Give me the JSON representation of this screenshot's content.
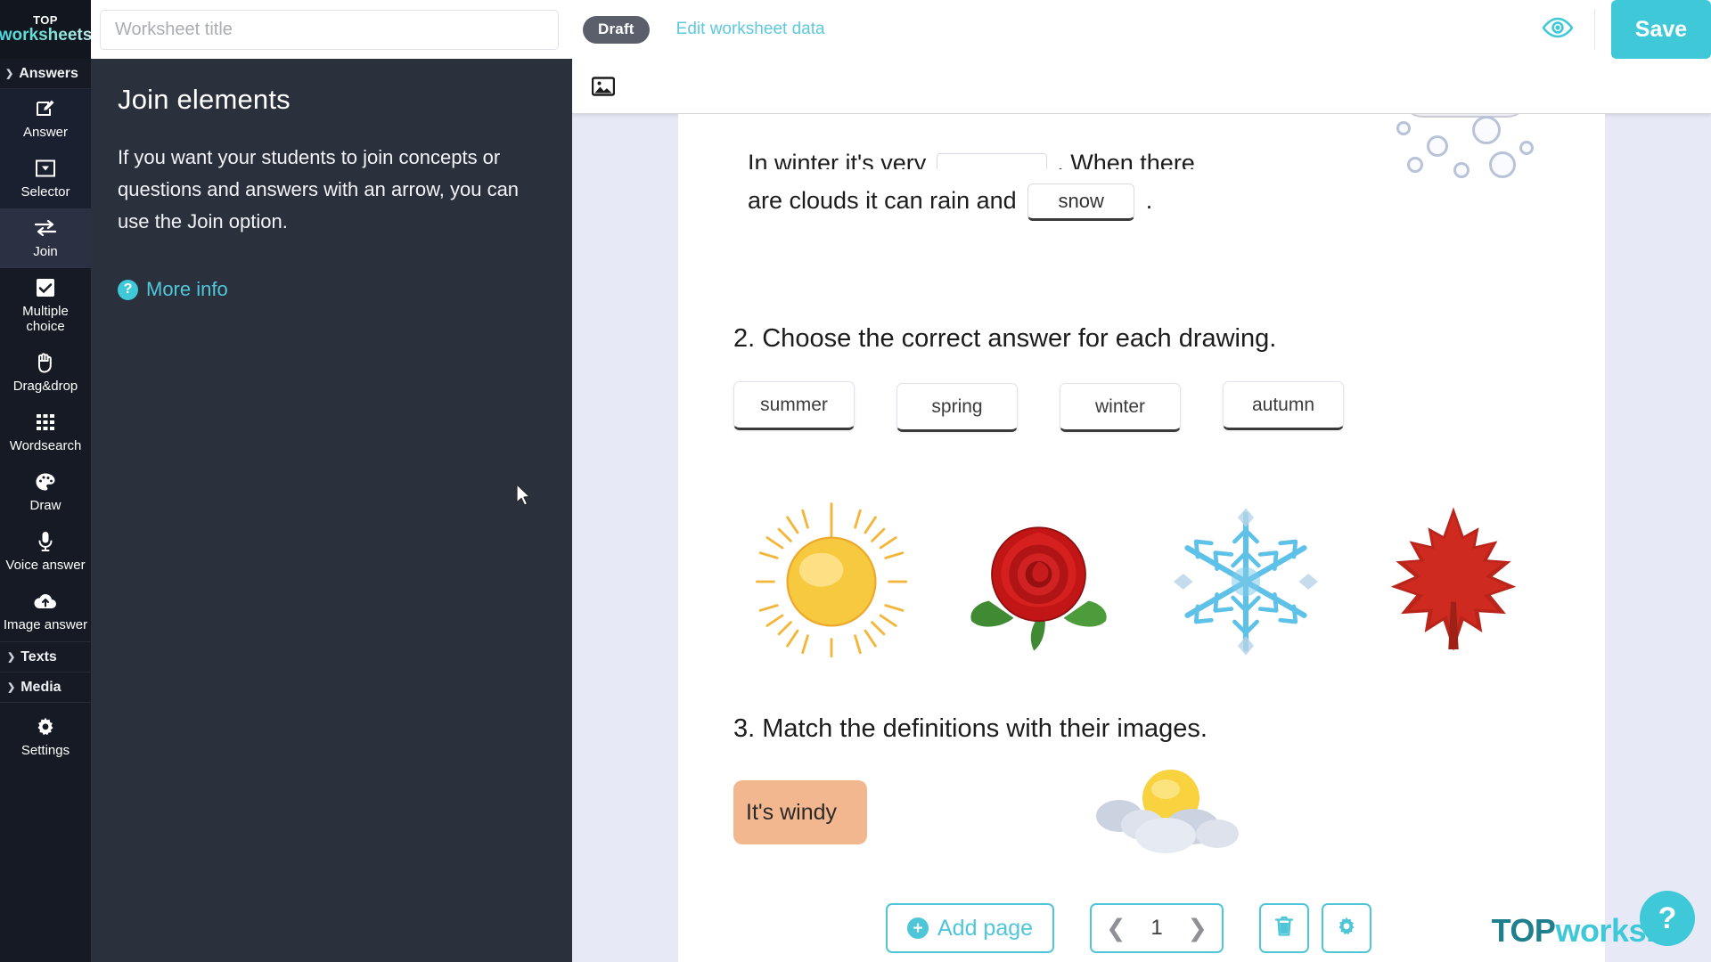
{
  "header": {
    "logo_top": "TOP",
    "logo_bottom": "worksheets",
    "title_placeholder": "Worksheet title",
    "title_value": "",
    "status_badge": "Draft",
    "edit_data_link": "Edit worksheet data",
    "preview_icon": "eye-icon",
    "save_label": "Save"
  },
  "rail": {
    "groups": [
      {
        "label": "Answers",
        "expanded": true,
        "chevron": "chevron-up-icon"
      }
    ],
    "items": [
      {
        "label": "Answer",
        "icon": "pencil-square-icon",
        "active": false,
        "sub": true
      },
      {
        "label": "Selector",
        "icon": "dropdown-box-icon",
        "active": false,
        "sub": true
      },
      {
        "label": "Join",
        "icon": "swap-arrows-icon",
        "active": true,
        "sub": false
      },
      {
        "label": "Multiple choice",
        "icon": "checkbox-icon",
        "active": false,
        "sub": false
      },
      {
        "label": "Drag&drop",
        "icon": "hand-icon",
        "active": false,
        "sub": false
      },
      {
        "label": "Wordsearch",
        "icon": "grid-icon",
        "active": false,
        "sub": false
      },
      {
        "label": "Draw",
        "icon": "palette-icon",
        "active": false,
        "sub": false
      },
      {
        "label": "Voice answer",
        "icon": "microphone-icon",
        "active": false,
        "sub": false
      },
      {
        "label": "Image answer",
        "icon": "cloud-upload-icon",
        "active": false,
        "sub": false
      }
    ],
    "sections": [
      {
        "label": "Texts",
        "chevron": "chevron-up-icon"
      },
      {
        "label": "Media",
        "chevron": "chevron-up-icon"
      }
    ],
    "settings": {
      "label": "Settings",
      "icon": "gear-icon"
    }
  },
  "panel": {
    "title": "Join elements",
    "body": "If you want your students to join concepts or questions and answers with an arrow, you can use the Join option.",
    "more_info": "More info",
    "more_info_icon": "question-circle-icon"
  },
  "canvas": {
    "toolbar_icon": "image-icon"
  },
  "worksheet": {
    "line1_pre": "In winter it's very",
    "line1_post": ". When there",
    "line2_pre": "are clouds it can rain and",
    "line2_field_value": "snow",
    "line2_post": ".",
    "q2_heading": "2. Choose the correct answer for each drawing.",
    "q2_answers": [
      "summer",
      "spring",
      "winter",
      "autumn"
    ],
    "q2_images": [
      "sun-image",
      "rose-image",
      "snowflake-image",
      "maple-leaf-image"
    ],
    "q3_heading": "3. Match the definitions with their images.",
    "q3_chip_text": "It's windy",
    "q3_art": "sun-behind-clouds-image"
  },
  "bottom": {
    "add_page_label": "Add page",
    "add_page_icon": "plus-circle-icon",
    "prev_icon": "chevron-left-icon",
    "next_icon": "chevron-right-icon",
    "page_number": "1",
    "delete_icon": "trash-icon",
    "settings_icon": "gear-icon"
  },
  "watermark": {
    "top": "TOP",
    "rest": "workshe"
  },
  "help": {
    "label": "?",
    "icon": "question-mark-icon"
  },
  "colors": {
    "accent": "#3fc8d8",
    "dark_rail": "#161a24",
    "panel_bg": "#2b303d",
    "canvas_bg": "#e7e9f7",
    "draft_badge": "#5b5f6b"
  }
}
